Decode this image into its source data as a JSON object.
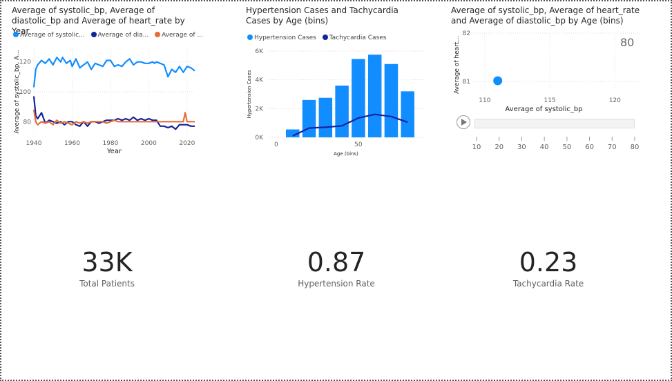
{
  "line_visual": {
    "title": "Average of systolic_bp, Average of diastolic_bp and Average of heart_rate by Year",
    "legend": [
      {
        "label": "Average of systolic...",
        "color": "#118DFF"
      },
      {
        "label": "Average of dia...",
        "color": "#12239E"
      },
      {
        "label": "Average of ...",
        "color": "#E66C37"
      }
    ]
  },
  "combo_visual": {
    "title": "Hypertension Cases and Tachycardia Cases by Age (bins)",
    "legend": [
      {
        "label": "Hypertension Cases",
        "color": "#118DFF"
      },
      {
        "label": "Tachycardia Cases",
        "color": "#12239E"
      }
    ]
  },
  "scatter_visual": {
    "title": "Average of systolic_bp, Average of heart_rate and Average of diastolic_bp by Age (bins)",
    "play_axis_value": "80"
  },
  "cards": [
    {
      "value": "33K",
      "label": "Total Patients"
    },
    {
      "value": "0.87",
      "label": "Hypertension Rate"
    },
    {
      "value": "0.23",
      "label": "Tachycardia Rate"
    }
  ],
  "chart_data": [
    {
      "type": "line",
      "title": "Average of systolic_bp, Average of diastolic_bp and Average of heart_rate by Year",
      "xlabel": "Year",
      "ylabel": "Average of systolic_bp, A...",
      "xlim": [
        1940,
        2024
      ],
      "ylim": [
        70,
        130
      ],
      "xticks": [
        1940,
        1960,
        1980,
        2000,
        2020
      ],
      "yticks": [
        80,
        100,
        120
      ],
      "grid": true,
      "legend_position": "top-left",
      "series": [
        {
          "name": "Average of systolic...",
          "color": "#118DFF",
          "x": [
            1940,
            1941,
            1942,
            1944,
            1946,
            1948,
            1950,
            1952,
            1954,
            1955,
            1957,
            1959,
            1960,
            1962,
            1964,
            1966,
            1968,
            1970,
            1972,
            1974,
            1976,
            1978,
            1980,
            1982,
            1984,
            1986,
            1988,
            1990,
            1992,
            1994,
            1996,
            1998,
            2000,
            2002,
            2003,
            2004,
            2006,
            2008,
            2010,
            2012,
            2014,
            2016,
            2018,
            2020,
            2022,
            2024
          ],
          "y": [
            103,
            115,
            118,
            121,
            119,
            122,
            118,
            123,
            120,
            123,
            119,
            121,
            117,
            122,
            116,
            118,
            120,
            115,
            119,
            118,
            117,
            121,
            121,
            117,
            118,
            117,
            120,
            122,
            118,
            120,
            120,
            119,
            119,
            120,
            119,
            120,
            119,
            118,
            110,
            115,
            113,
            117,
            113,
            117,
            116,
            114
          ]
        },
        {
          "name": "Average of dia...",
          "color": "#12239E",
          "x": [
            1940,
            1941,
            1942,
            1944,
            1946,
            1948,
            1950,
            1952,
            1954,
            1956,
            1958,
            1960,
            1962,
            1964,
            1966,
            1968,
            1970,
            1972,
            1974,
            1976,
            1978,
            1980,
            1982,
            1984,
            1986,
            1988,
            1990,
            1992,
            1994,
            1996,
            1998,
            2000,
            2002,
            2004,
            2006,
            2008,
            2010,
            2012,
            2014,
            2016,
            2018,
            2020,
            2022,
            2024
          ],
          "y": [
            97,
            84,
            82,
            86,
            79,
            81,
            80,
            79,
            80,
            78,
            80,
            80,
            78,
            77,
            80,
            77,
            80,
            80,
            79,
            80,
            81,
            81,
            81,
            82,
            81,
            82,
            81,
            83,
            81,
            82,
            81,
            82,
            81,
            81,
            77,
            77,
            76,
            77,
            75,
            78,
            78,
            78,
            77,
            77
          ]
        },
        {
          "name": "Average of ...",
          "color": "#E66C37",
          "x": [
            1940,
            1941,
            1942,
            1944,
            1946,
            1948,
            1950,
            1952,
            1954,
            1956,
            1958,
            1960,
            1962,
            1964,
            1966,
            1968,
            1970,
            1972,
            1974,
            1976,
            1978,
            1980,
            1982,
            1984,
            1986,
            1988,
            1990,
            1992,
            1994,
            1996,
            1998,
            2000,
            2002,
            2004,
            2006,
            2008,
            2010,
            2012,
            2014,
            2016,
            2018,
            2019,
            2020,
            2022,
            2024
          ],
          "y": [
            88,
            80,
            78,
            80,
            79,
            80,
            78,
            81,
            79,
            80,
            79,
            78,
            80,
            79,
            80,
            79,
            80,
            80,
            80,
            80,
            79,
            80,
            81,
            80,
            80,
            80,
            80,
            80,
            80,
            80,
            80,
            80,
            80,
            80,
            80,
            80,
            80,
            80,
            80,
            80,
            80,
            86,
            80,
            80,
            80
          ]
        }
      ]
    },
    {
      "type": "bar",
      "title": "Hypertension Cases and Tachycardia Cases by Age (bins)",
      "xlabel": "Age (bins)",
      "ylabel": "Hypertension Cases",
      "xlim": [
        0,
        90
      ],
      "ylim": [
        0,
        6000
      ],
      "xticks": [
        0,
        50
      ],
      "yticks": [
        0,
        2000,
        4000,
        6000
      ],
      "ytick_labels": [
        "0K",
        "2K",
        "4K",
        "6K"
      ],
      "legend_position": "top-left",
      "categories": [
        10,
        20,
        30,
        40,
        50,
        60,
        70,
        80
      ],
      "series": [
        {
          "name": "Hypertension Cases",
          "type": "bar",
          "color": "#118DFF",
          "values": [
            550,
            2600,
            2750,
            3600,
            5450,
            5750,
            5100,
            3200
          ]
        },
        {
          "name": "Tachycardia Cases",
          "type": "line",
          "color": "#12239E",
          "values": [
            100,
            650,
            700,
            800,
            1350,
            1600,
            1450,
            1050
          ]
        }
      ]
    },
    {
      "type": "scatter",
      "title": "Average of systolic_bp, Average of heart_rate and Average of diastolic_bp by Age (bins)",
      "xlabel": "Average of systolic_bp",
      "ylabel": "Average of heart...",
      "xlim": [
        109,
        122
      ],
      "ylim": [
        80.8,
        82
      ],
      "xticks": [
        110,
        115,
        120
      ],
      "yticks": [
        81,
        82
      ],
      "play_axis": [
        10,
        20,
        30,
        40,
        50,
        60,
        70,
        80
      ],
      "play_axis_current": 80,
      "points": [
        {
          "x": 111,
          "y": 80.9,
          "color": "#118DFF"
        }
      ]
    }
  ]
}
